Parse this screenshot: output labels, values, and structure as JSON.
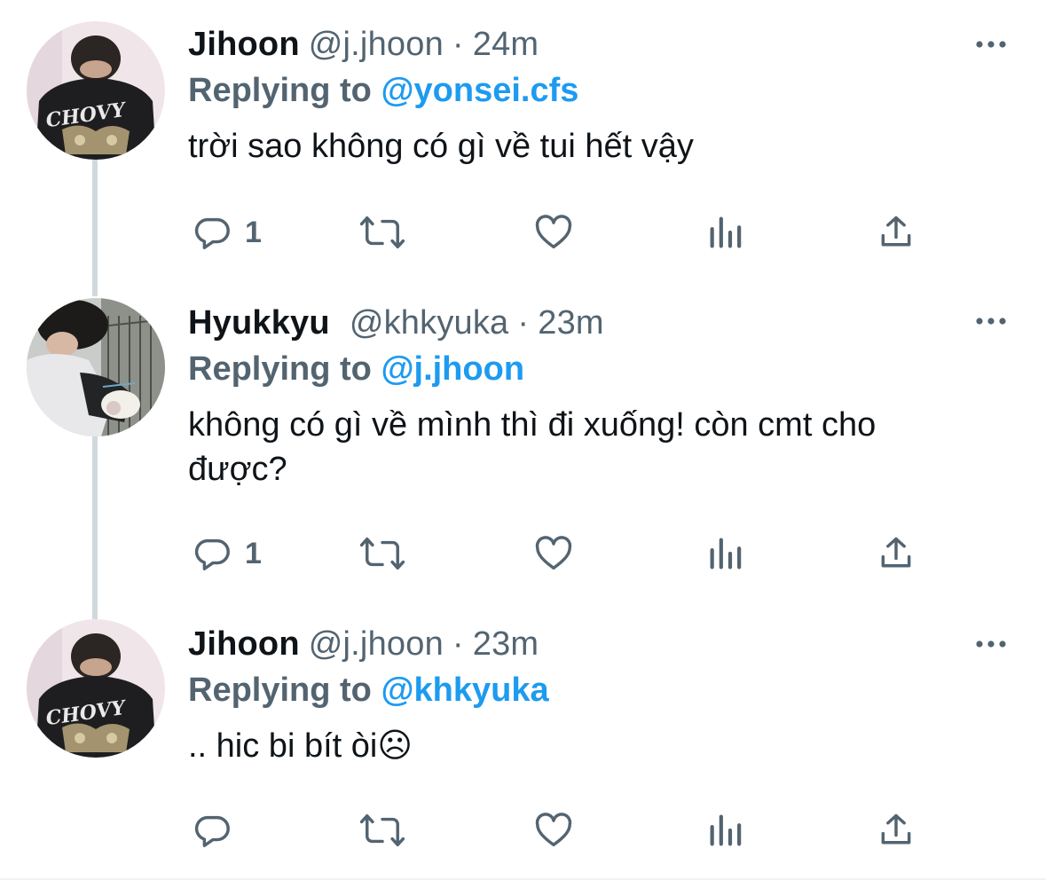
{
  "tweets": [
    {
      "name": "Jihoon",
      "handle": "@j.jhoon",
      "separator": "·",
      "time": "24m",
      "replying_prefix": "Replying to",
      "replying_to": "@yonsei.cfs",
      "text": "trời sao không có gì về tui hết vậy",
      "reply_count": "1",
      "avatar_shirt_text": "CHOVY"
    },
    {
      "name": "Hyukkyu",
      "handle": "@khkyuka",
      "separator": "·",
      "time": "23m",
      "replying_prefix": "Replying to",
      "replying_to": "@j.jhoon",
      "text": "không có gì về mình thì đi xuống! còn cmt cho được?",
      "reply_count": "1"
    },
    {
      "name": "Jihoon",
      "handle": "@j.jhoon",
      "separator": "·",
      "time": "23m",
      "replying_prefix": "Replying to",
      "replying_to": "@khkyuka",
      "text": ".. hic bi bít òi☹",
      "reply_count": "",
      "avatar_shirt_text": "CHOVY"
    }
  ],
  "icons": {
    "reply": "reply-icon",
    "retweet": "retweet-icon",
    "like": "heart-icon",
    "views": "views-icon",
    "share": "share-icon",
    "more": "more-icon"
  },
  "colors": {
    "accent": "#1d9bf0",
    "secondary_text": "#536471",
    "primary_text": "#0f1419",
    "thread_line": "#cfd9de"
  }
}
